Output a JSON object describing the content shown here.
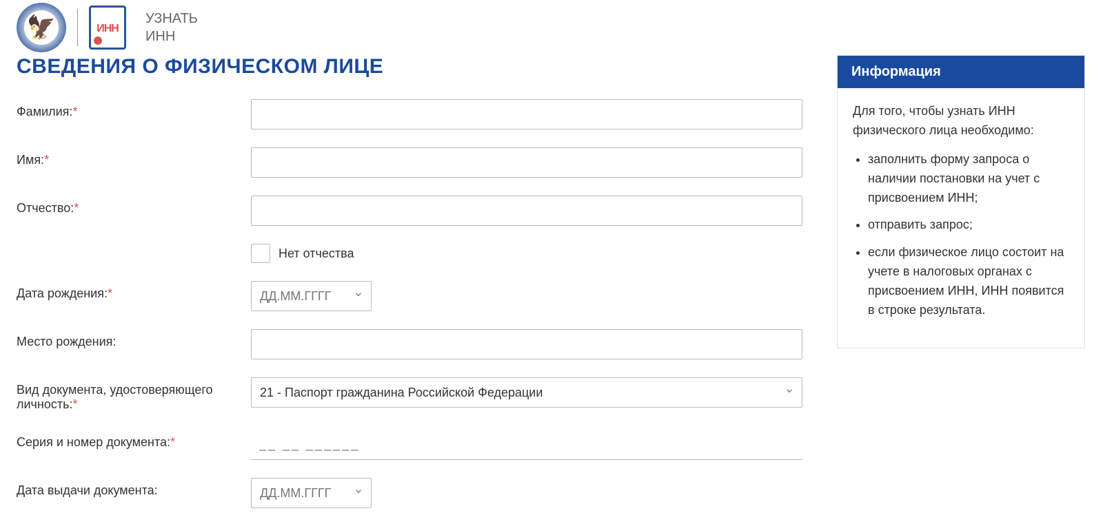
{
  "header": {
    "title_line1": "УЗНАТЬ",
    "title_line2": "ИНН",
    "inn_badge": "ИНН"
  },
  "section_title": "СВЕДЕНИЯ О ФИЗИЧЕСКОМ ЛИЦЕ",
  "form": {
    "surname_label": "Фамилия:",
    "name_label": "Имя:",
    "patronymic_label": "Отчество:",
    "no_patronymic_label": "Нет отчества",
    "birthdate_label": "Дата рождения:",
    "birthdate_placeholder": "ДД.ММ.ГГГГ",
    "birthplace_label": "Место рождения:",
    "doc_type_label": "Вид документа, удостоверяющего личность:",
    "doc_type_value": "21 - Паспорт гражданина Российской Федерации",
    "doc_series_label": "Серия и номер документа:",
    "doc_series_mask": "__ __ ______",
    "doc_issue_date_label": "Дата выдачи документа:",
    "doc_issue_date_placeholder": "ДД.ММ.ГГГГ"
  },
  "sidebar": {
    "title": "Информация",
    "intro": "Для того, чтобы узнать ИНН физического лица необходимо:",
    "items": [
      "заполнить форму запроса о наличии постановки на учет с присвоением ИНН;",
      "отправить запрос;",
      "если физическое лицо состоит на учете в налоговых органах с присвоением ИНН, ИНН появится в строке результата."
    ]
  }
}
